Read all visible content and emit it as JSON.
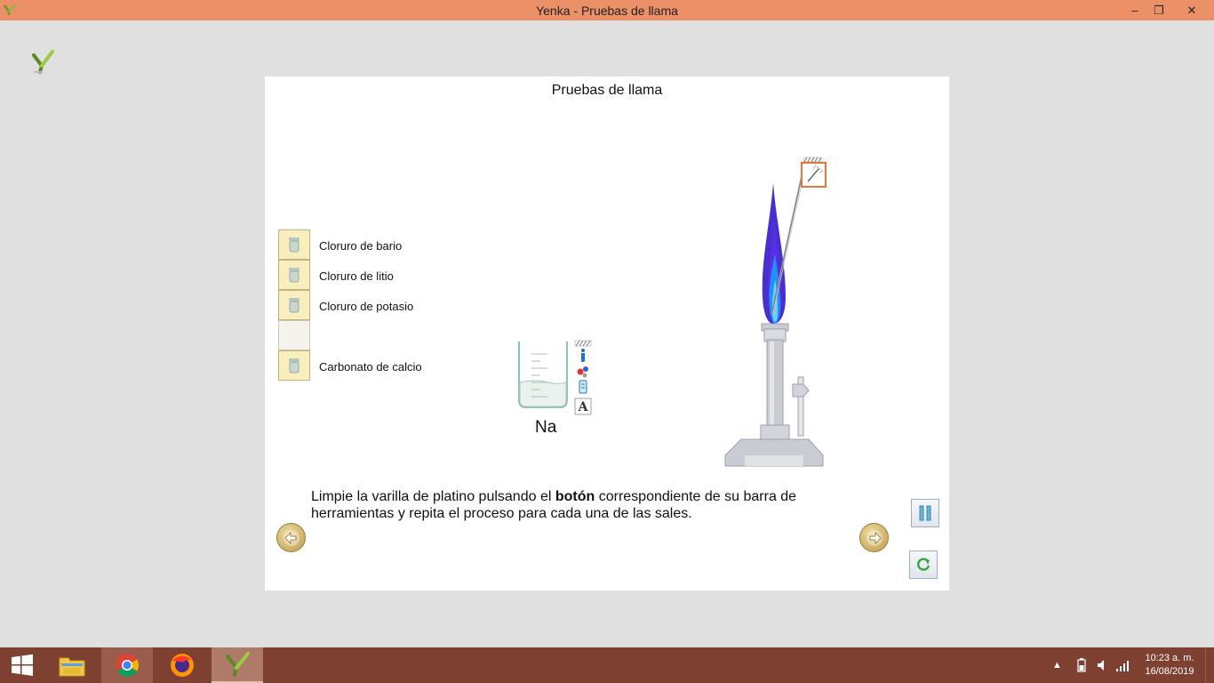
{
  "window": {
    "title": "Yenka - Pruebas de llama",
    "controls": {
      "minimize": "–",
      "maximize": "❐",
      "close": "✕"
    }
  },
  "panel": {
    "title": "Pruebas de llama",
    "salts": [
      {
        "label": "Cloruro de bario",
        "filled": true
      },
      {
        "label": "Cloruro de litio",
        "filled": true
      },
      {
        "label": "Cloruro de potasio",
        "filled": true
      },
      {
        "label": "",
        "filled": false
      },
      {
        "label": "Carbonato de calcio",
        "filled": true
      }
    ],
    "beaker": {
      "label": "Na"
    },
    "instruction": {
      "part1": "Limpie la varilla de platino pulsando el ",
      "bold": "botón",
      "part2": " correspondiente de su barra de herramientas y repita el proceso para cada una de las sales."
    },
    "flame_color": "#3a1ec8",
    "accent_color": "#e8743a"
  },
  "taskbar": {
    "clock_time": "10:23 a. m.",
    "clock_date": "16/08/2019",
    "tray_up": "▲"
  }
}
